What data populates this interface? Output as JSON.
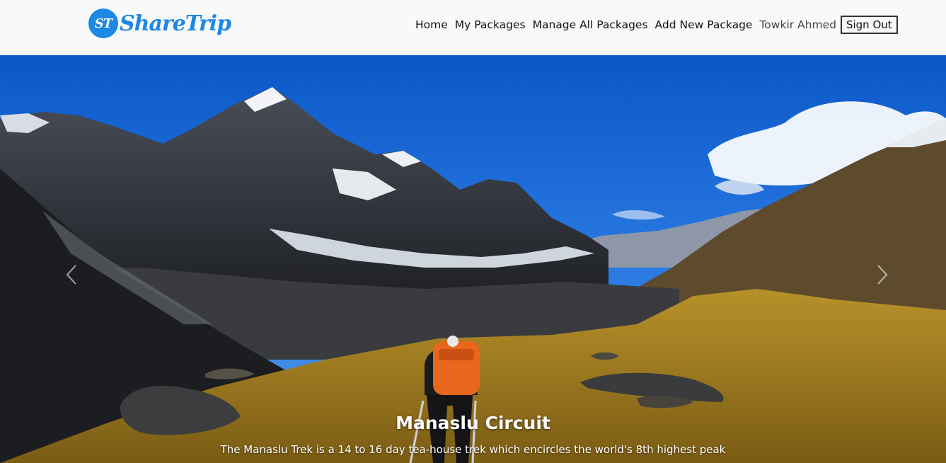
{
  "brand": {
    "logo_text": "ST",
    "name": "ShareTrip",
    "color": "#1e88e5"
  },
  "nav": {
    "links": [
      "Home",
      "My Packages",
      "Manage All Packages",
      "Add New Package"
    ],
    "user_name": "Towkir Ahmed",
    "signout_label": "Sign Out"
  },
  "carousel": {
    "title": "Manaslu Circuit",
    "text": "The Manaslu Trek is a 14 to 16 day tea-house trek which encircles the world's 8th highest peak",
    "prev_icon": "chevron-left-icon",
    "next_icon": "chevron-right-icon"
  }
}
